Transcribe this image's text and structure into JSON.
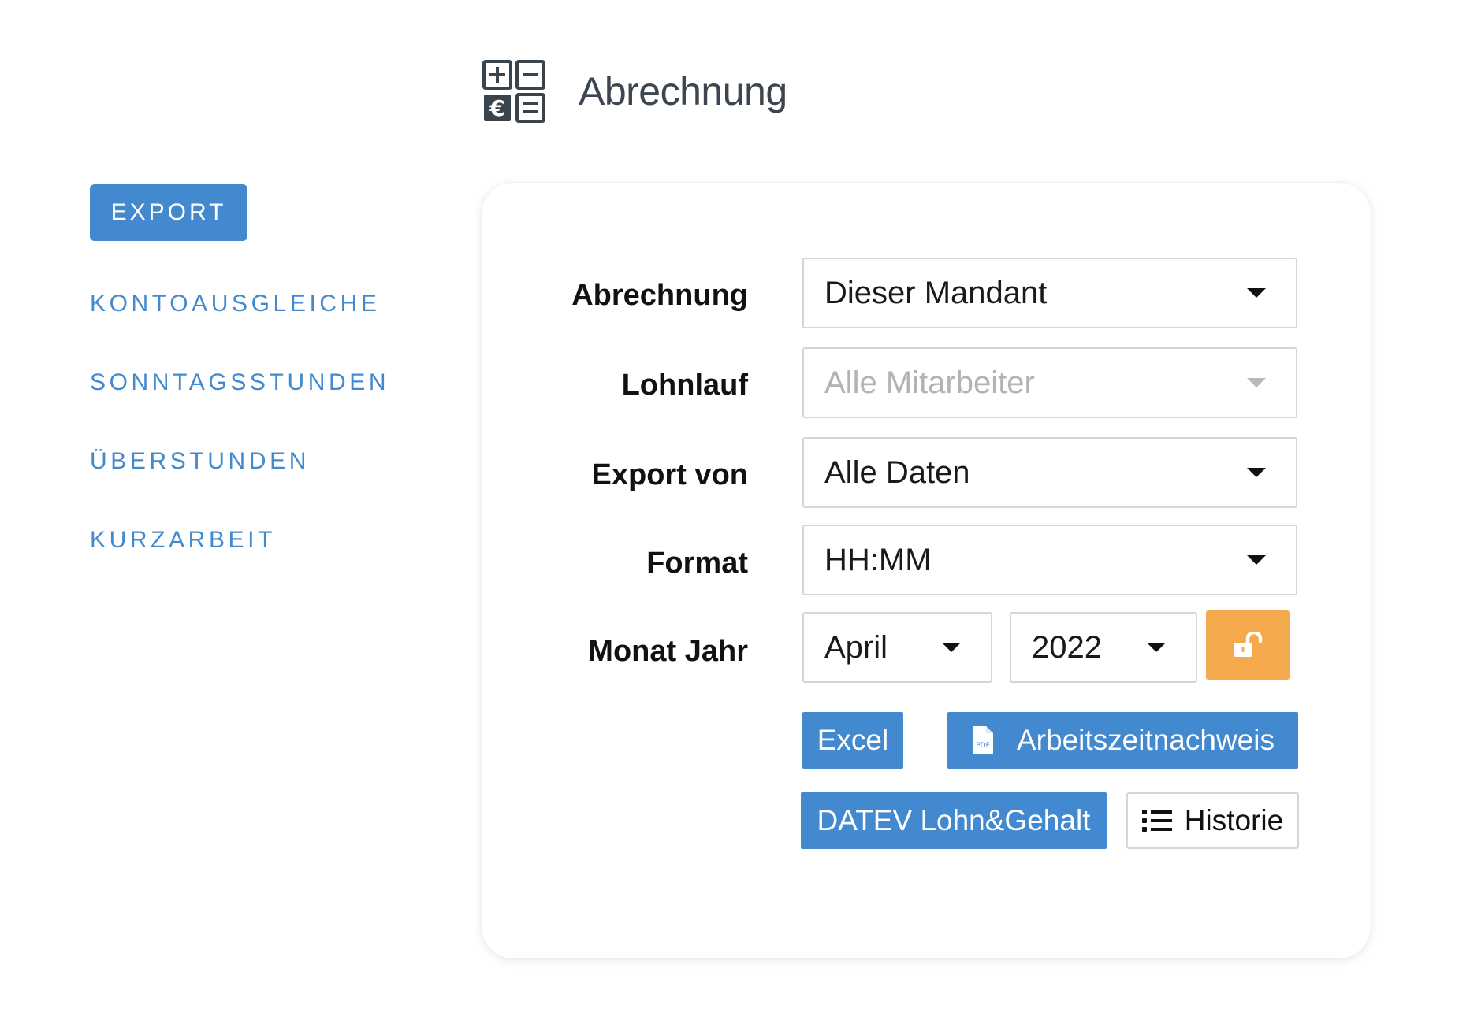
{
  "header": {
    "title": "Abrechnung",
    "icon": "calculator-icon"
  },
  "sidebar": {
    "export_label": "EXPORT",
    "items": [
      {
        "label": "KONTOAUSGLEICHE"
      },
      {
        "label": "SONNTAGSSTUNDEN"
      },
      {
        "label": "ÜBERSTUNDEN"
      },
      {
        "label": "KURZARBEIT"
      }
    ]
  },
  "form": {
    "abrechnung": {
      "label": "Abrechnung",
      "value": "Dieser Mandant"
    },
    "lohnlauf": {
      "label": "Lohnlauf",
      "value": "Alle Mitarbeiter",
      "disabled": true
    },
    "export_von": {
      "label": "Export von",
      "value": "Alle Daten"
    },
    "format": {
      "label": "Format",
      "value": "HH:MM"
    },
    "monat_jahr": {
      "label": "Monat Jahr",
      "month": "April",
      "year": "2022",
      "lock_icon": "unlock-icon"
    }
  },
  "buttons": {
    "excel": "Excel",
    "arbeitszeitnachweis": "Arbeitszeitnachweis",
    "arbeitszeitnachweis_icon": "pdf-file-icon",
    "pdf_icon_text": "PDF",
    "datev": "DATEV Lohn&Gehalt",
    "historie": "Historie",
    "historie_icon": "list-icon"
  },
  "colors": {
    "accent": "#4289cf",
    "warning": "#f5a94d",
    "header_text": "#3d4650",
    "icon_dark": "#3a444d"
  }
}
